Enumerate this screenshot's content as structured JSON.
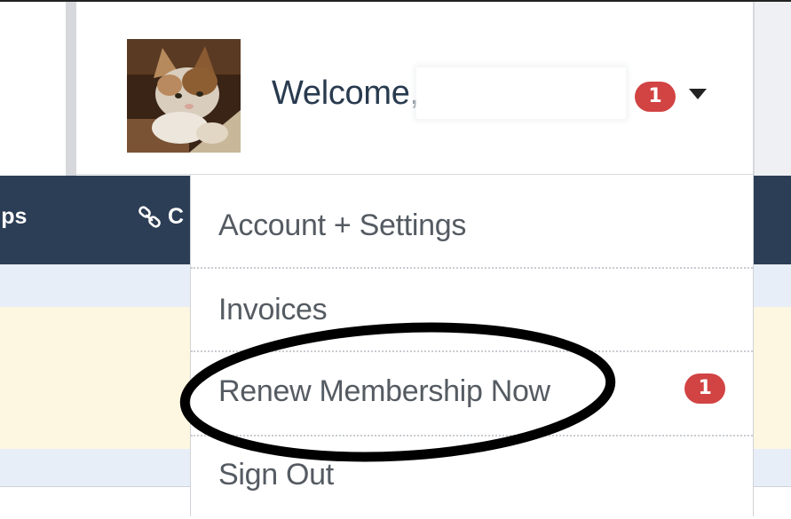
{
  "header": {
    "welcome_text": "Welcome,",
    "notification_count": "1",
    "avatar_icon": "cat-photo-avatar",
    "caret_icon": "caret-down-icon"
  },
  "navbar": {
    "items": [
      {
        "label": "ups"
      },
      {
        "label": "C",
        "icon": "link-icon"
      }
    ]
  },
  "dropdown": {
    "items": [
      {
        "label": "Account + Settings"
      },
      {
        "label": "Invoices"
      },
      {
        "label": "Renew Membership Now",
        "badge": "1"
      },
      {
        "label": "Sign Out"
      }
    ]
  },
  "colors": {
    "navbar_bg": "#2c3e55",
    "badge_bg": "#d24343",
    "text_dark": "#283a4e",
    "menu_text": "#555b62",
    "highlight_band": "#fdf7e1",
    "light_band": "#e8eef7"
  }
}
